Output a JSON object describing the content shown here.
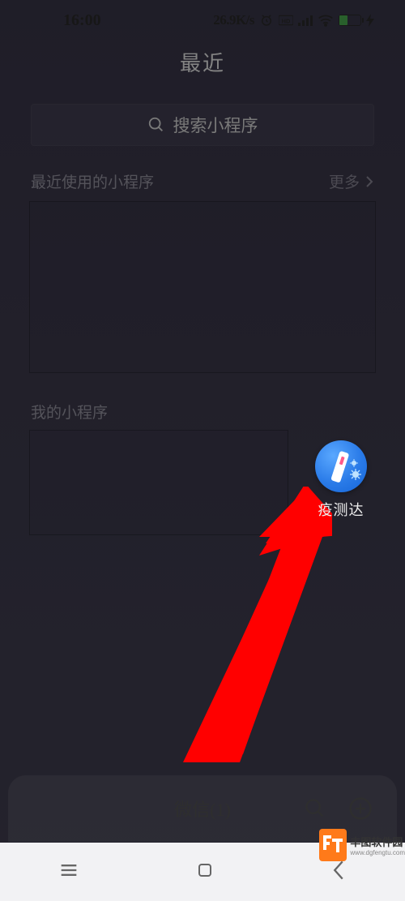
{
  "status": {
    "time": "16:00",
    "speed": "26.9K/s",
    "battery_percent": 38
  },
  "title": "最近",
  "search": {
    "label": "搜索小程序"
  },
  "sections": {
    "recent": {
      "label": "最近使用的小程序",
      "more": "更多"
    },
    "mine": {
      "label": "我的小程序"
    }
  },
  "mini_program": {
    "name": "疫测达"
  },
  "chat_tab": {
    "label": "微信(1)"
  },
  "watermark": {
    "brand": "丰图软件园",
    "url": "www.dgfengtu.com"
  }
}
